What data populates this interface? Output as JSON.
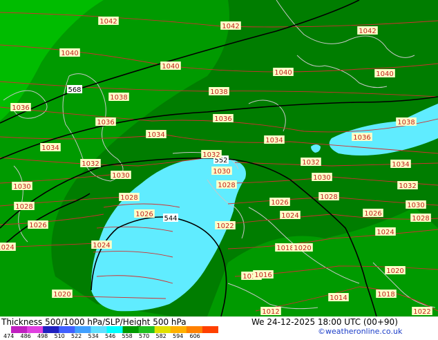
{
  "title": "Thickness 500/1000 hPa/SLP/Height 500 hPa",
  "valid_time": "We 24-12-2025 18:00 UTC (00+90)",
  "credit": "©weatheronline.co.uk",
  "legend": {
    "ticks": [
      "474",
      "486",
      "498",
      "510",
      "522",
      "534",
      "546",
      "558",
      "570",
      "582",
      "594",
      "606"
    ],
    "colors": [
      "#c020c0",
      "#e040e0",
      "#2020c0",
      "#4060ff",
      "#40a0ff",
      "#60e0ff",
      "#00ffff",
      "#009a00",
      "#20c020",
      "#e0e000",
      "#ffb000",
      "#ff8000",
      "#ff4000"
    ]
  },
  "colors": {
    "thickness_552_558": "#007d00",
    "thickness_558_564": "#009a00",
    "thickness_564_570": "#00a800",
    "thickness_570_576": "#00bc00",
    "thickness_cold": "#60ecff",
    "isobar": "#d03030",
    "height_contour": "#000000",
    "coastline": "#c8c8c8"
  },
  "height_labels": [
    {
      "id": "h568",
      "text": "568"
    },
    {
      "id": "h552",
      "text": "552"
    },
    {
      "id": "h544",
      "text": "544"
    }
  ],
  "isobar_labels": [
    {
      "id": "p1",
      "text": "1042"
    },
    {
      "id": "p2",
      "text": "1042"
    },
    {
      "id": "p3",
      "text": "1042"
    },
    {
      "id": "p4",
      "text": "1040"
    },
    {
      "id": "p5",
      "text": "1040"
    },
    {
      "id": "p6",
      "text": "1040"
    },
    {
      "id": "p7",
      "text": "1040"
    },
    {
      "id": "p8",
      "text": "1038"
    },
    {
      "id": "p9",
      "text": "1038"
    },
    {
      "id": "p10",
      "text": "1036"
    },
    {
      "id": "p11",
      "text": "1036"
    },
    {
      "id": "p12",
      "text": "1036"
    },
    {
      "id": "p13",
      "text": "1038"
    },
    {
      "id": "p14",
      "text": "1034"
    },
    {
      "id": "p15",
      "text": "1034"
    },
    {
      "id": "p16",
      "text": "1032"
    },
    {
      "id": "p17",
      "text": "1034"
    },
    {
      "id": "p18",
      "text": "1036"
    },
    {
      "id": "p19",
      "text": "1032"
    },
    {
      "id": "p20",
      "text": "1030"
    },
    {
      "id": "p21",
      "text": "1030"
    },
    {
      "id": "p22",
      "text": "1032"
    },
    {
      "id": "p23",
      "text": "1034"
    },
    {
      "id": "p24",
      "text": "1030"
    },
    {
      "id": "p25",
      "text": "1028"
    },
    {
      "id": "p26",
      "text": "1028"
    },
    {
      "id": "p27",
      "text": "1030"
    },
    {
      "id": "p28",
      "text": "1032"
    },
    {
      "id": "p29",
      "text": "1028"
    },
    {
      "id": "p30",
      "text": "1028"
    },
    {
      "id": "p31",
      "text": "1026"
    },
    {
      "id": "p32",
      "text": "1026"
    },
    {
      "id": "p33",
      "text": "1024"
    },
    {
      "id": "p34",
      "text": "1030"
    },
    {
      "id": "p35",
      "text": "1026"
    },
    {
      "id": "p36",
      "text": "1026"
    },
    {
      "id": "p37",
      "text": "1022"
    },
    {
      "id": "p38",
      "text": "1028"
    },
    {
      "id": "p39",
      "text": "1024"
    },
    {
      "id": "p40",
      "text": "1024"
    },
    {
      "id": "p41",
      "text": "1018"
    },
    {
      "id": "p42",
      "text": "1020"
    },
    {
      "id": "p43",
      "text": "1024"
    },
    {
      "id": "p44",
      "text": "1020"
    },
    {
      "id": "p45",
      "text": "1016"
    },
    {
      "id": "p46",
      "text": "1016"
    },
    {
      "id": "p47",
      "text": "1018"
    },
    {
      "id": "p48",
      "text": "1020"
    },
    {
      "id": "p49",
      "text": "1014"
    },
    {
      "id": "p50",
      "text": "1012"
    },
    {
      "id": "p51",
      "text": "1022"
    }
  ]
}
